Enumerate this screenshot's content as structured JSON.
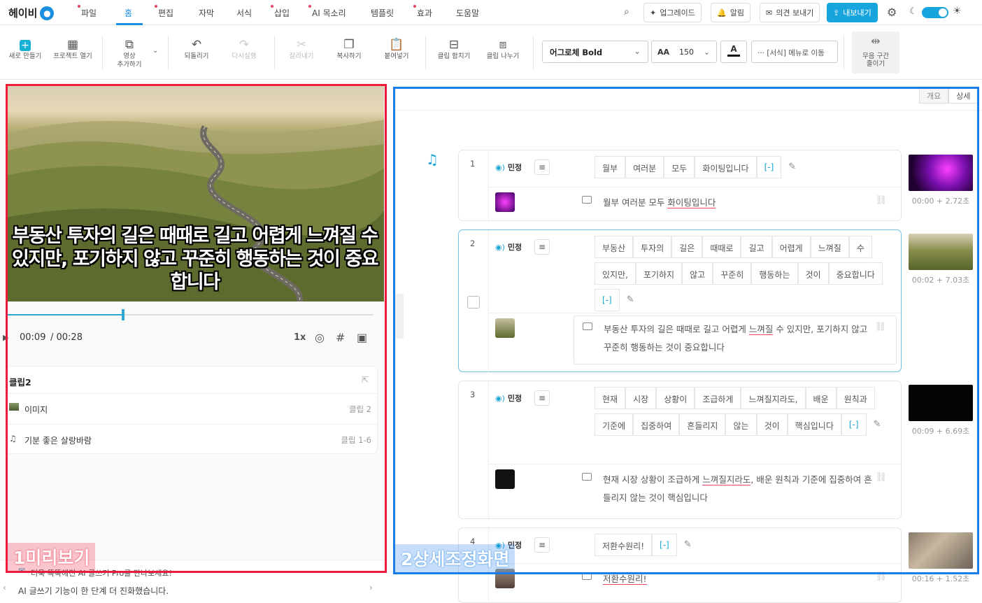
{
  "brand": {
    "name": "헤이비"
  },
  "menu": [
    {
      "label": "파일",
      "dot": true
    },
    {
      "label": "홈",
      "active": true
    },
    {
      "label": "편집",
      "dot": true
    },
    {
      "label": "자막"
    },
    {
      "label": "서식"
    },
    {
      "label": "삽입",
      "dot": true
    },
    {
      "label": "AI 목소리",
      "dot": true
    },
    {
      "label": "템플릿"
    },
    {
      "label": "효과",
      "dot": true
    },
    {
      "label": "도움말"
    }
  ],
  "topbar": {
    "upgrade": "업그레이드",
    "notify": "알림",
    "feedback": "의견 보내기",
    "export": "내보내기"
  },
  "toolbar": {
    "new": "새로 만들기",
    "open": "프로젝트 열기",
    "add_video_1": "영상",
    "add_video_2": "추가하기",
    "undo": "되돌리기",
    "redo": "다시실행",
    "cut": "잘라내기",
    "copy": "복사하기",
    "paste": "붙여넣기",
    "merge": "클립 합치기",
    "split": "클립 나누기",
    "font": "어그로체 Bold",
    "font_size": "150",
    "font_color_label": "A",
    "format_move": "··· [서식] 메뉴로 이동",
    "silence_1": "무음 구간",
    "silence_2": "줄이기"
  },
  "preview": {
    "caption": "부동산 투자의 길은 때때로 길고 어렵게 느껴질 수 있지만, 포기하지 않고 꾸준히 행동하는 것이 중요합니다",
    "time_current": "00:09",
    "time_total": "/ 00:28",
    "progress": 0.32,
    "speed": "1x"
  },
  "clip_panel": {
    "title": "클립2",
    "rows": [
      {
        "label": "이미지",
        "right": "클립 2"
      },
      {
        "label": "기분 좋은 살랑바람",
        "right": "클립 1-6"
      }
    ]
  },
  "tip": {
    "line1": "더욱 똑똑해진 AI 글쓰기 Pro를 만나보세요!",
    "line2": "AI 글쓰기 기능이 한 단계 더 진화했습니다."
  },
  "right_tabs": [
    "개요",
    "상세"
  ],
  "speaker": "민정",
  "bracket_token": "[-]",
  "clips": [
    {
      "num": "1",
      "words": [
        "월부",
        "여러분",
        "모두",
        "화이팅입니다"
      ],
      "subtitle_pre": "월부 여러분 모두 ",
      "subtitle_mark": "화이팅입니다",
      "subtitle_post": "",
      "time": "00:00 + 2.72초",
      "thumb_text": "월부 여러분 모두 화이팅입니다"
    },
    {
      "num": "2",
      "words": [
        "부동산",
        "투자의",
        "길은",
        "때때로",
        "길고",
        "어렵게",
        "느껴질",
        "수",
        "있지만,",
        "포기하지",
        "않고",
        "꾸준히",
        "행동하는",
        "것이",
        "중요합니다"
      ],
      "subtitle_pre": "부동산 투자의 길은 때때로 길고 어렵게 ",
      "subtitle_mark": "느껴질",
      "subtitle_post": " 수 있지만, 포기하지 않고 꾸준히 행동하는 것이 중요합니다",
      "time": "00:02 + 7.03초",
      "thumb_text": "부동산 투자의 길은 때때로 길고 어렵게 느껴질 수 있지만, 포기하지 않고 꾸준히 행동하는 것이 중요합니다"
    },
    {
      "num": "3",
      "words": [
        "현재",
        "시장",
        "상황이",
        "조급하게",
        "느껴질지라도,",
        "배운",
        "원칙과",
        "기준에",
        "집중하여",
        "흔들리지",
        "않는",
        "것이",
        "핵심입니다"
      ],
      "subtitle_pre": "현재 시장 상황이 조급하게 ",
      "subtitle_mark": "느껴질지라도",
      "subtitle_post": ", 배운 원칙과 기준에 집중하여 흔들리지 않는 것이 핵심입니다",
      "time": "00:09 + 6.69초",
      "thumb_text": "현재 시장 상황이 조급하게 느껴질지라도, 배운 원칙과 기준에 집중하여 흔들리지 않는 것이 핵심입니다"
    },
    {
      "num": "4",
      "words": [
        "저환수원리!"
      ],
      "subtitle_pre": "",
      "subtitle_mark": "저환수원리!",
      "subtitle_post": "",
      "time": "00:16 + 1.52초",
      "thumb_text": "저환수원리!"
    }
  ],
  "annotations": {
    "preview": "1미리보기",
    "detail": "2상세조정화면"
  },
  "colors": {
    "accent": "#18a4dc",
    "annot_red": "#ee1c3a",
    "annot_blue": "#1b7de8"
  }
}
